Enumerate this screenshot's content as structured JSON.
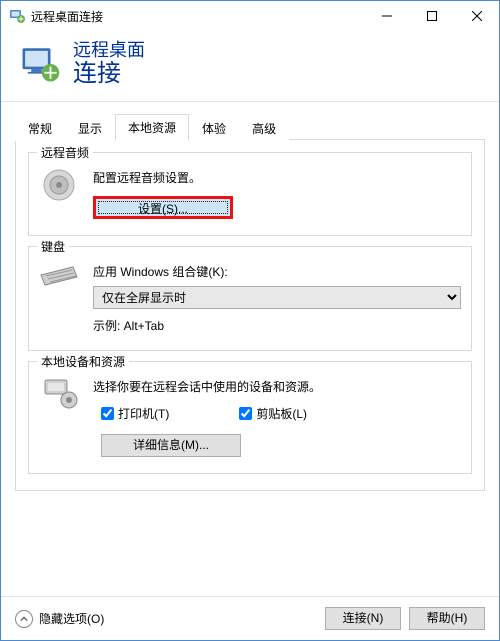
{
  "window": {
    "title": "远程桌面连接"
  },
  "header": {
    "line1": "远程桌面",
    "line2": "连接"
  },
  "tabs": {
    "items": [
      {
        "label": "常规"
      },
      {
        "label": "显示"
      },
      {
        "label": "本地资源"
      },
      {
        "label": "体验"
      },
      {
        "label": "高级"
      }
    ],
    "active_index": 2
  },
  "audio_group": {
    "title": "远程音频",
    "text": "配置远程音频设置。",
    "settings_button": "设置(S)..."
  },
  "keyboard_group": {
    "title": "键盘",
    "label": "应用 Windows 组合键(K):",
    "selected": "仅在全屏显示时",
    "example": "示例: Alt+Tab"
  },
  "devices_group": {
    "title": "本地设备和资源",
    "text": "选择你要在远程会话中使用的设备和资源。",
    "printer_label": "打印机(T)",
    "clipboard_label": "剪贴板(L)",
    "printer_checked": true,
    "clipboard_checked": true,
    "more_button": "详细信息(M)..."
  },
  "footer": {
    "hide_options": "隐藏选项(O)",
    "connect": "连接(N)",
    "help": "帮助(H)"
  }
}
